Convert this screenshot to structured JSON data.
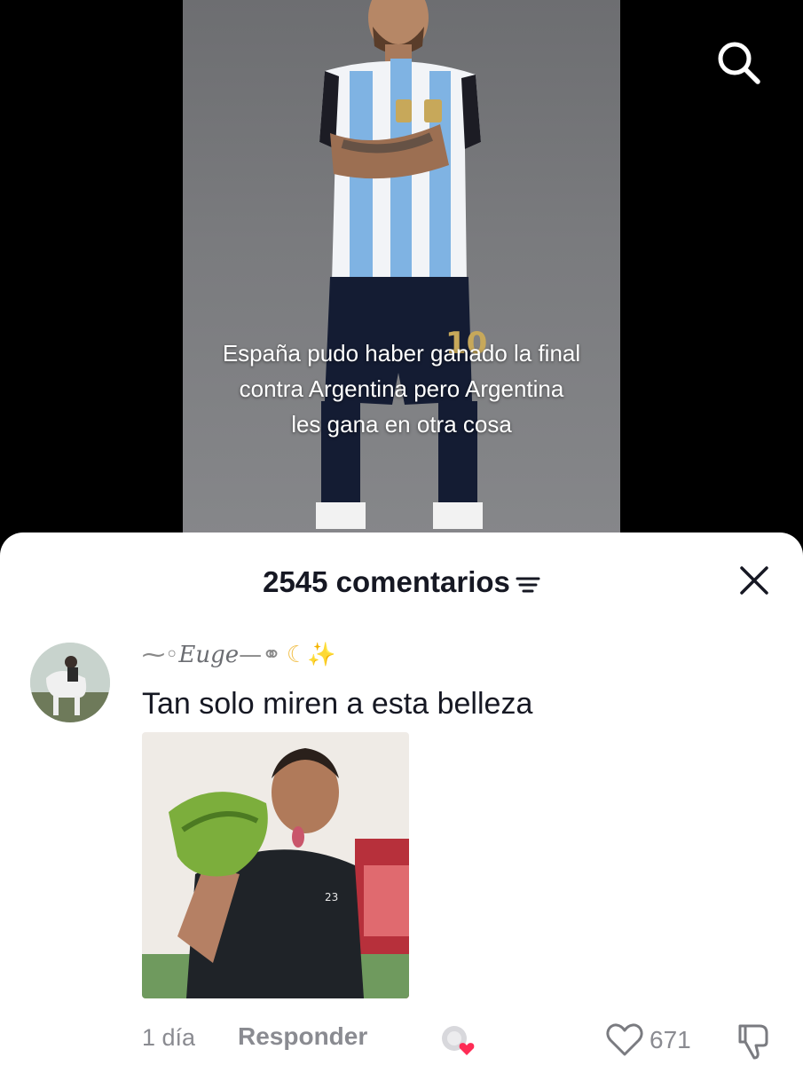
{
  "video": {
    "caption_lines": [
      "España pudo haber ganado la final",
      "contra Argentina pero Argentina",
      "les gana en otra cosa"
    ]
  },
  "top_bar": {
    "search_icon": "search-icon"
  },
  "comments_sheet": {
    "count_label": "2545 comentarios",
    "filter_icon": "filter-icon",
    "close_icon": "close-icon"
  },
  "comment": {
    "username_prefix": "⁓◦",
    "username_name": "Euge",
    "username_rings": "—⚭",
    "username_moon": "☾",
    "username_sparkle": "✨",
    "text": "Tan solo miren a esta belleza",
    "time": "1 día",
    "reply_label": "Responder",
    "like_count": "671"
  },
  "colors": {
    "sheet_bg": "#ffffff",
    "primary_text": "#161823",
    "secondary_text": "#8a8b91",
    "heart_red": "#fe2c55"
  }
}
